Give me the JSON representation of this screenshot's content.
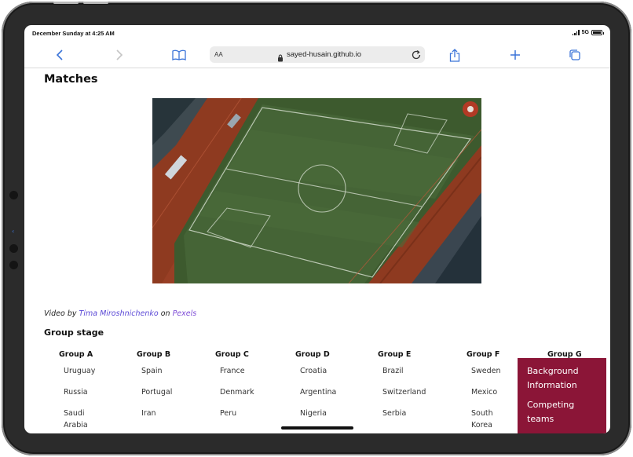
{
  "status_bar": {
    "time": "December Sunday at 4:25 AM",
    "network": "5G"
  },
  "toolbar": {
    "back_icon": "chevron-left-icon",
    "forward_icon": "chevron-right-icon",
    "bookmarks_icon": "book-icon",
    "aa_label": "AA",
    "url": "sayed-husain.github.io",
    "reload_icon": "reload-icon",
    "share_icon": "share-icon",
    "new_tab_icon": "plus-icon",
    "tabs_icon": "tabs-icon"
  },
  "page": {
    "title": "Matches",
    "video_alt": "Aerial view of football stadium",
    "credit": {
      "prefix": "Video by ",
      "author": "Tima Miroshnichenko",
      "middle": " on ",
      "source": "Pexels"
    },
    "group_stage_title": "Group stage",
    "groups": [
      {
        "name": "Group A",
        "teams": [
          "Uruguay",
          "Russia",
          "Saudi Arabia"
        ]
      },
      {
        "name": "Group B",
        "teams": [
          "Spain",
          "Portugal",
          "Iran"
        ]
      },
      {
        "name": "Group C",
        "teams": [
          "France",
          "Denmark",
          "Peru"
        ]
      },
      {
        "name": "Group D",
        "teams": [
          "Croatia",
          "Argentina",
          "Nigeria"
        ]
      },
      {
        "name": "Group E",
        "teams": [
          "Brazil",
          "Switzerland",
          "Serbia"
        ]
      },
      {
        "name": "Group F",
        "teams": [
          "Sweden",
          "Mexico",
          "South Korea"
        ]
      },
      {
        "name": "Group G",
        "teams": []
      }
    ]
  },
  "side_menu": {
    "items": [
      "Background Information",
      "Competing teams"
    ]
  },
  "colors": {
    "menu_bg": "#8b1537",
    "link": "#5b49d6",
    "accent_blue": "#3b74d8"
  }
}
